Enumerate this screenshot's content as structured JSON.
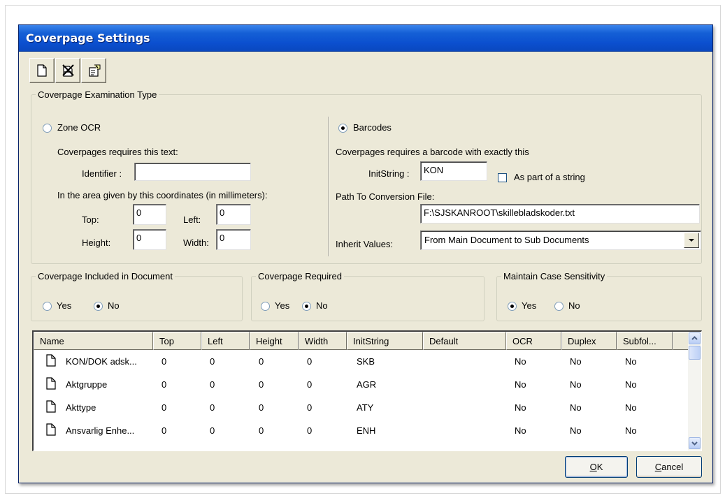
{
  "window": {
    "title": "Coverpage Settings"
  },
  "toolbar": {
    "buttons": [
      {
        "icon": "new-document-icon"
      },
      {
        "icon": "delete-document-icon"
      },
      {
        "icon": "properties-icon"
      }
    ]
  },
  "exam_type": {
    "legend": "Coverpage Examination Type",
    "zone_ocr": {
      "label": "Zone OCR",
      "selected": false,
      "requires_text_label": "Coverpages requires this text:",
      "identifier_label": "Identifier :",
      "identifier_value": "",
      "area_label": "In the area given by this coordinates (in millimeters):",
      "top_label": "Top:",
      "top_value": "0",
      "left_label": "Left:",
      "left_value": "0",
      "height_label": "Height:",
      "height_value": "0",
      "width_label": "Width:",
      "width_value": "0"
    },
    "barcodes": {
      "label": "Barcodes",
      "selected": true,
      "requires_label": "Coverpages requires a barcode with exactly this",
      "initstring_label": "InitString :",
      "initstring_value": "KON",
      "as_part_label": "As part of a string",
      "as_part_checked": false,
      "path_label": "Path To Conversion File:",
      "path_value": "F:\\SJSKANROOT\\skillebladskoder.txt",
      "inherit_label": "Inherit Values:",
      "inherit_value": "From Main Document to Sub Documents"
    }
  },
  "included": {
    "legend": "Coverpage Included in Document",
    "yes": "Yes",
    "no": "No",
    "selected": "No"
  },
  "required": {
    "legend": "Coverpage Required",
    "yes": "Yes",
    "no": "No",
    "selected": "No"
  },
  "case": {
    "legend": "Maintain Case Sensitivity",
    "yes": "Yes",
    "no": "No",
    "selected": "Yes"
  },
  "table": {
    "columns": [
      "Name",
      "Top",
      "Left",
      "Height",
      "Width",
      "InitString",
      "Default",
      "OCR",
      "Duplex",
      "Subfol..."
    ],
    "rows": [
      {
        "name": "KON/DOK adsk...",
        "top": "0",
        "left": "0",
        "height": "0",
        "width": "0",
        "initstring": "SKB",
        "default": "",
        "ocr": "No",
        "duplex": "No",
        "subfolder": "No"
      },
      {
        "name": "Aktgruppe",
        "top": "0",
        "left": "0",
        "height": "0",
        "width": "0",
        "initstring": "AGR",
        "default": "",
        "ocr": "No",
        "duplex": "No",
        "subfolder": "No"
      },
      {
        "name": "Akttype",
        "top": "0",
        "left": "0",
        "height": "0",
        "width": "0",
        "initstring": "ATY",
        "default": "",
        "ocr": "No",
        "duplex": "No",
        "subfolder": "No"
      },
      {
        "name": "Ansvarlig Enhe...",
        "top": "0",
        "left": "0",
        "height": "0",
        "width": "0",
        "initstring": "ENH",
        "default": "",
        "ocr": "No",
        "duplex": "No",
        "subfolder": "No"
      }
    ]
  },
  "buttons": {
    "ok": "OK",
    "cancel": "Cancel"
  },
  "colors": {
    "titlebar": "#0b4fcf",
    "dialog": "#ece9d8",
    "button_border": "#003c74"
  }
}
